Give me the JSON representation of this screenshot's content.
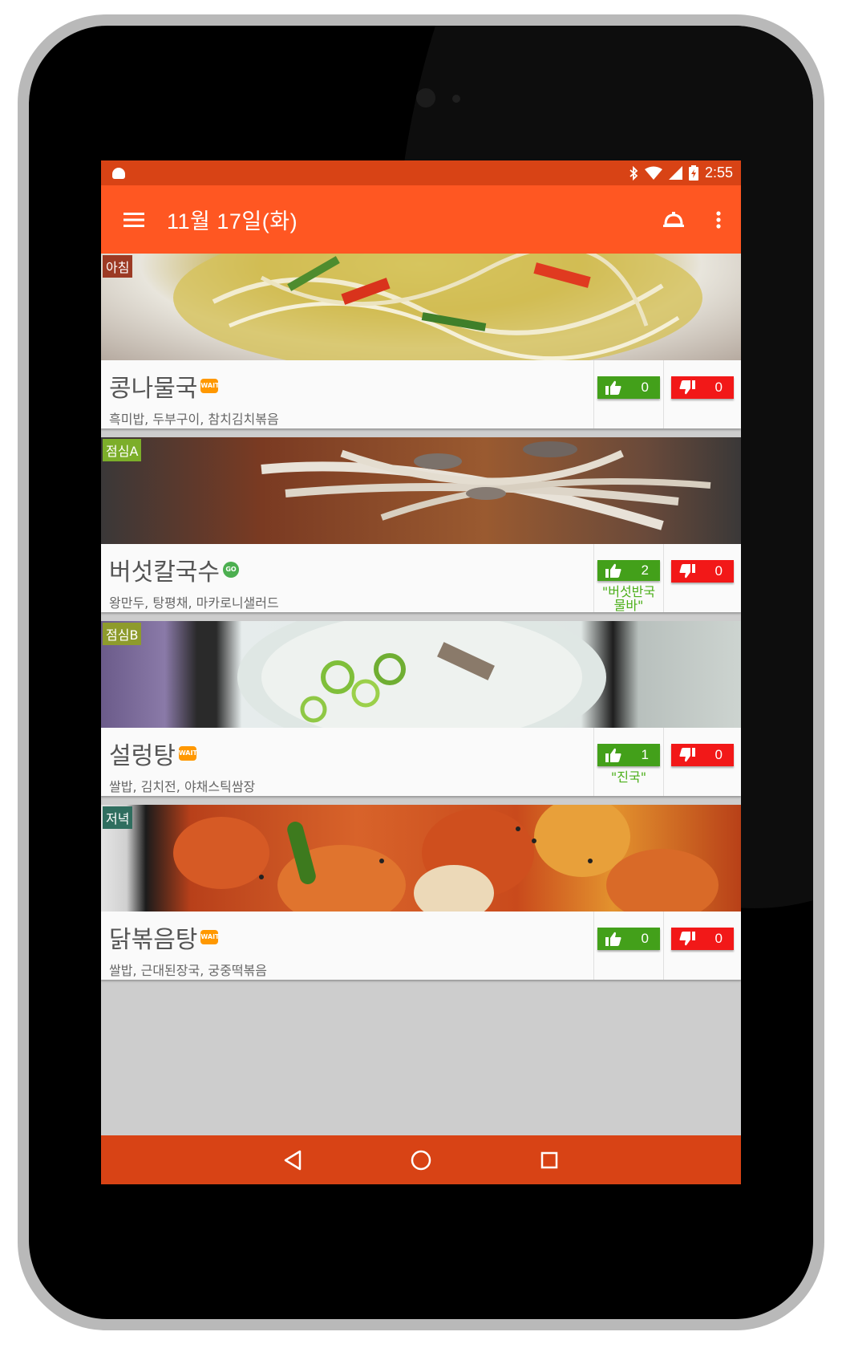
{
  "status_bar": {
    "time": "2:55"
  },
  "app_bar": {
    "title": "11월 17일(화)"
  },
  "meals": [
    {
      "tag": "아침",
      "tag_color": "#9c3a24",
      "name": "콩나물국",
      "badge": "WAIT",
      "sides": "흑미밥, 두부구이, 참치김치볶음",
      "likes": "0",
      "dislikes": "0",
      "comment": ""
    },
    {
      "tag": "점심A",
      "tag_color": "#7cae2a",
      "name": "버섯칼국수",
      "badge": "GO",
      "sides": "왕만두, 탕평채, 마카로니샐러드",
      "likes": "2",
      "dislikes": "0",
      "comment": "\"버섯반국물바\""
    },
    {
      "tag": "점심B",
      "tag_color": "#8e9b2c",
      "name": "설렁탕",
      "badge": "WAIT",
      "sides": "쌀밥, 김치전, 야채스틱쌈장",
      "likes": "1",
      "dislikes": "0",
      "comment": "\"진국\""
    },
    {
      "tag": "저녁",
      "tag_color": "#2f6e5f",
      "name": "닭볶음탕",
      "badge": "WAIT",
      "sides": "쌀밥, 근대된장국, 궁중떡볶음",
      "likes": "0",
      "dislikes": "0",
      "comment": ""
    }
  ],
  "colors": {
    "primary": "#ff5722",
    "primary_dark": "#d84315",
    "like": "#43a01a",
    "dislike": "#f21818",
    "comment": "#4caf1a"
  },
  "icons": {
    "menu": "hamburger-menu-icon",
    "alarm": "alarm-bell-icon",
    "overflow": "more-vert-icon",
    "like": "thumb-up-icon",
    "dislike": "thumb-down-icon",
    "back": "back-triangle-icon",
    "home": "home-circle-icon",
    "recents": "recents-square-icon"
  }
}
